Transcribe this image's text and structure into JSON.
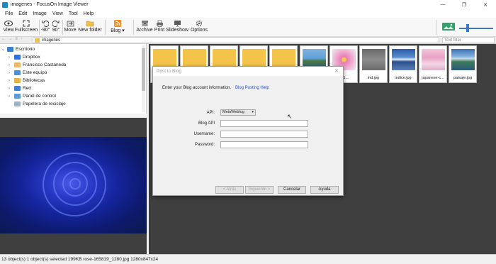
{
  "window": {
    "title": "imagenes - FocusOn Image Viewer",
    "controls": [
      "—",
      "❐",
      "✕"
    ]
  },
  "menu": [
    "File",
    "Edit",
    "Image",
    "View",
    "Tool",
    "Help"
  ],
  "toolbar": {
    "view": "View",
    "fullscreen": "Fullscreen",
    "rotate_left": "-90°",
    "rotate_right": "90°",
    "move": "Move",
    "new_folder": "New folder",
    "blog": "Blog",
    "archive": "Archive",
    "print": "Print",
    "slideshow": "Slideshow",
    "options": "Options"
  },
  "address": {
    "nav_glyphs": "← → ≡ ↑",
    "path": "imagenes",
    "filter_placeholder": "Text filter"
  },
  "tree": {
    "items": [
      {
        "label": "Escritorio",
        "icon": "desktop-icon",
        "expanded": true
      },
      {
        "label": "Dropbox",
        "icon": "dropbox-icon"
      },
      {
        "label": "Francisco Castaneda",
        "icon": "user-icon"
      },
      {
        "label": "Este equipo",
        "icon": "computer-icon"
      },
      {
        "label": "Bibliotecas",
        "icon": "library-icon"
      },
      {
        "label": "Red",
        "icon": "network-icon"
      },
      {
        "label": "Panel de control",
        "icon": "control-panel-icon"
      },
      {
        "label": "Papelera de reciclaje",
        "icon": "recycle-bin-icon"
      }
    ]
  },
  "thumbnails": [
    {
      "label": "",
      "type": "folder"
    },
    {
      "label": "",
      "type": "folder"
    },
    {
      "label": "",
      "type": "folder"
    },
    {
      "label": "",
      "type": "folder"
    },
    {
      "label": "",
      "type": "folder"
    },
    {
      "label": "",
      "type": "image"
    },
    {
      "label": "r-31...",
      "type": "image"
    },
    {
      "label": "ind.jpg",
      "type": "image"
    },
    {
      "label": "indice.jpg",
      "type": "image"
    },
    {
      "label": "japanese-c...",
      "type": "image"
    },
    {
      "label": "paisaje.jpg",
      "type": "image"
    }
  ],
  "dialog": {
    "title": "Post to Blog",
    "close": "✕",
    "intro": "Enter your Blog account information.",
    "help_link": "Blog Posting Help",
    "api_label": "API:",
    "api_value": "MetaWeblog",
    "blog_api_label": "Blog API",
    "username_label": "Username:",
    "password_label": "Password:",
    "back_button": "< Atrás",
    "next_button": "Siguiente >",
    "cancel_button": "Cancelar",
    "help_button": "Ayuda"
  },
  "status": {
    "text": "13 object(s)  1 object(s) selected  199KB  rose-165819_1280.jpg  1280x847x24"
  },
  "colors": {
    "accent": "#3a78c5",
    "folder": "#f4c44a",
    "link": "#2a4fbf",
    "viewer_bg": "#3f3f3f"
  }
}
